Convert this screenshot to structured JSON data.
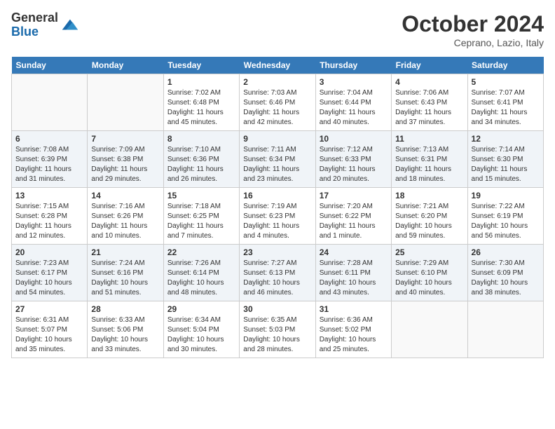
{
  "header": {
    "logo_general": "General",
    "logo_blue": "Blue",
    "month": "October 2024",
    "location": "Ceprano, Lazio, Italy"
  },
  "days_of_week": [
    "Sunday",
    "Monday",
    "Tuesday",
    "Wednesday",
    "Thursday",
    "Friday",
    "Saturday"
  ],
  "weeks": [
    [
      {
        "day": "",
        "info": ""
      },
      {
        "day": "",
        "info": ""
      },
      {
        "day": "1",
        "info": "Sunrise: 7:02 AM\nSunset: 6:48 PM\nDaylight: 11 hours and 45 minutes."
      },
      {
        "day": "2",
        "info": "Sunrise: 7:03 AM\nSunset: 6:46 PM\nDaylight: 11 hours and 42 minutes."
      },
      {
        "day": "3",
        "info": "Sunrise: 7:04 AM\nSunset: 6:44 PM\nDaylight: 11 hours and 40 minutes."
      },
      {
        "day": "4",
        "info": "Sunrise: 7:06 AM\nSunset: 6:43 PM\nDaylight: 11 hours and 37 minutes."
      },
      {
        "day": "5",
        "info": "Sunrise: 7:07 AM\nSunset: 6:41 PM\nDaylight: 11 hours and 34 minutes."
      }
    ],
    [
      {
        "day": "6",
        "info": "Sunrise: 7:08 AM\nSunset: 6:39 PM\nDaylight: 11 hours and 31 minutes."
      },
      {
        "day": "7",
        "info": "Sunrise: 7:09 AM\nSunset: 6:38 PM\nDaylight: 11 hours and 29 minutes."
      },
      {
        "day": "8",
        "info": "Sunrise: 7:10 AM\nSunset: 6:36 PM\nDaylight: 11 hours and 26 minutes."
      },
      {
        "day": "9",
        "info": "Sunrise: 7:11 AM\nSunset: 6:34 PM\nDaylight: 11 hours and 23 minutes."
      },
      {
        "day": "10",
        "info": "Sunrise: 7:12 AM\nSunset: 6:33 PM\nDaylight: 11 hours and 20 minutes."
      },
      {
        "day": "11",
        "info": "Sunrise: 7:13 AM\nSunset: 6:31 PM\nDaylight: 11 hours and 18 minutes."
      },
      {
        "day": "12",
        "info": "Sunrise: 7:14 AM\nSunset: 6:30 PM\nDaylight: 11 hours and 15 minutes."
      }
    ],
    [
      {
        "day": "13",
        "info": "Sunrise: 7:15 AM\nSunset: 6:28 PM\nDaylight: 11 hours and 12 minutes."
      },
      {
        "day": "14",
        "info": "Sunrise: 7:16 AM\nSunset: 6:26 PM\nDaylight: 11 hours and 10 minutes."
      },
      {
        "day": "15",
        "info": "Sunrise: 7:18 AM\nSunset: 6:25 PM\nDaylight: 11 hours and 7 minutes."
      },
      {
        "day": "16",
        "info": "Sunrise: 7:19 AM\nSunset: 6:23 PM\nDaylight: 11 hours and 4 minutes."
      },
      {
        "day": "17",
        "info": "Sunrise: 7:20 AM\nSunset: 6:22 PM\nDaylight: 11 hours and 1 minute."
      },
      {
        "day": "18",
        "info": "Sunrise: 7:21 AM\nSunset: 6:20 PM\nDaylight: 10 hours and 59 minutes."
      },
      {
        "day": "19",
        "info": "Sunrise: 7:22 AM\nSunset: 6:19 PM\nDaylight: 10 hours and 56 minutes."
      }
    ],
    [
      {
        "day": "20",
        "info": "Sunrise: 7:23 AM\nSunset: 6:17 PM\nDaylight: 10 hours and 54 minutes."
      },
      {
        "day": "21",
        "info": "Sunrise: 7:24 AM\nSunset: 6:16 PM\nDaylight: 10 hours and 51 minutes."
      },
      {
        "day": "22",
        "info": "Sunrise: 7:26 AM\nSunset: 6:14 PM\nDaylight: 10 hours and 48 minutes."
      },
      {
        "day": "23",
        "info": "Sunrise: 7:27 AM\nSunset: 6:13 PM\nDaylight: 10 hours and 46 minutes."
      },
      {
        "day": "24",
        "info": "Sunrise: 7:28 AM\nSunset: 6:11 PM\nDaylight: 10 hours and 43 minutes."
      },
      {
        "day": "25",
        "info": "Sunrise: 7:29 AM\nSunset: 6:10 PM\nDaylight: 10 hours and 40 minutes."
      },
      {
        "day": "26",
        "info": "Sunrise: 7:30 AM\nSunset: 6:09 PM\nDaylight: 10 hours and 38 minutes."
      }
    ],
    [
      {
        "day": "27",
        "info": "Sunrise: 6:31 AM\nSunset: 5:07 PM\nDaylight: 10 hours and 35 minutes."
      },
      {
        "day": "28",
        "info": "Sunrise: 6:33 AM\nSunset: 5:06 PM\nDaylight: 10 hours and 33 minutes."
      },
      {
        "day": "29",
        "info": "Sunrise: 6:34 AM\nSunset: 5:04 PM\nDaylight: 10 hours and 30 minutes."
      },
      {
        "day": "30",
        "info": "Sunrise: 6:35 AM\nSunset: 5:03 PM\nDaylight: 10 hours and 28 minutes."
      },
      {
        "day": "31",
        "info": "Sunrise: 6:36 AM\nSunset: 5:02 PM\nDaylight: 10 hours and 25 minutes."
      },
      {
        "day": "",
        "info": ""
      },
      {
        "day": "",
        "info": ""
      }
    ]
  ]
}
